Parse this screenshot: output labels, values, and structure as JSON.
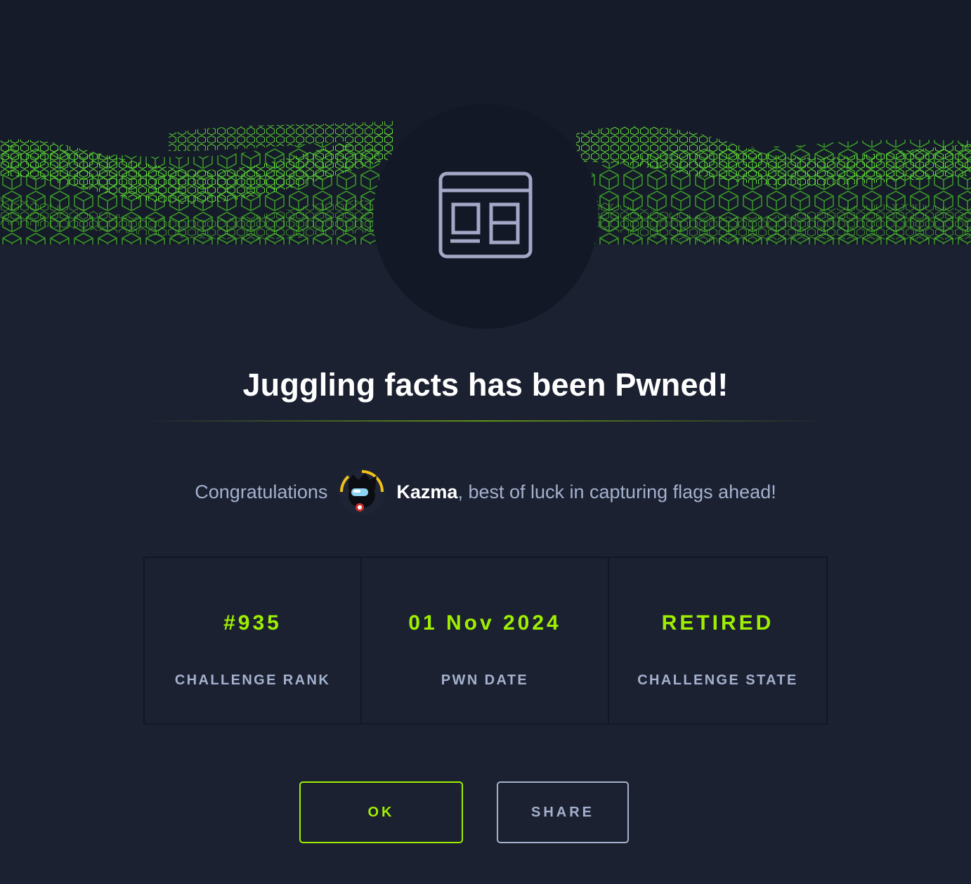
{
  "hero": {
    "icon": "browser-window-icon"
  },
  "title": "Juggling facts has been Pwned!",
  "congrats": {
    "prefix": "Congratulations",
    "username": "Kazma",
    "suffix": ", best of luck in capturing flags ahead!"
  },
  "stats": [
    {
      "value": "#935",
      "label": "CHALLENGE RANK"
    },
    {
      "value": "01 Nov 2024",
      "label": "PWN DATE"
    },
    {
      "value": "RETIRED",
      "label": "CHALLENGE STATE"
    }
  ],
  "buttons": {
    "ok": "OK",
    "share": "SHARE"
  },
  "colors": {
    "background": "#1b2131",
    "accent": "#9fef00",
    "muted_text": "#a4b1cd",
    "title": "#ffffff"
  }
}
